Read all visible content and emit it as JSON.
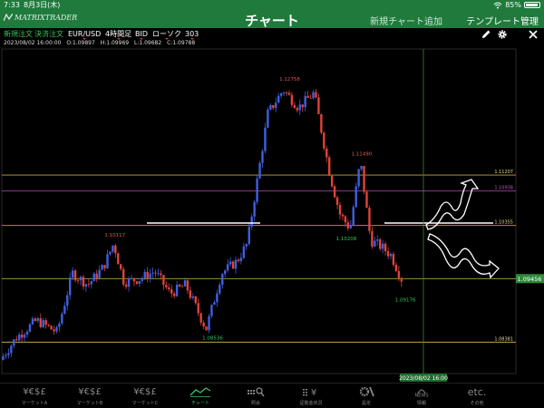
{
  "status_bar": {
    "time": "7:33",
    "date": "8月3日(木)",
    "battery_pct": "85%"
  },
  "header": {
    "logo": "MATRIXTRADER",
    "title": "チャート",
    "add_chart": "新規チャート追加",
    "template_manage": "テンプレート管理"
  },
  "toolbar": {
    "new_order": "新規注文",
    "settle_order": "決済注文",
    "symbol": "EUR/USD",
    "timeframe": "4時間足",
    "price_type": "BID",
    "chart_type": "ローソク",
    "count": "303"
  },
  "ohlc": {
    "datetime": "2023/08/02 16:00:00",
    "open": "O:1.09897",
    "high": "H:1.09969",
    "low": "L:1.09682",
    "close": "C:1.09788"
  },
  "chart_data": {
    "type": "candlestick",
    "ylim": [
      1.0785,
      1.1334
    ],
    "price_scale": [
      "1.11207",
      "1.10938",
      "1.10355",
      "1.09456",
      "1.08381"
    ],
    "current_price": "1.09456",
    "horizontal_lines": [
      {
        "price": 1.11207,
        "color": "#c8a43a"
      },
      {
        "price": 1.10938,
        "color": "#8a3a8a"
      },
      {
        "price": 1.10355,
        "color": "#c8a43a"
      },
      {
        "price": 1.08381,
        "color": "#c8a43a"
      },
      {
        "price": 1.09456,
        "color": "#9ab23a"
      }
    ],
    "annotations": [
      {
        "label": "1.12758",
        "x": 0.56,
        "price": 1.12758,
        "color": "#e05a5a"
      },
      {
        "label": "1.11490",
        "x": 0.7,
        "price": 1.1149,
        "color": "#e05a5a"
      },
      {
        "label": "1.10117",
        "x": 0.22,
        "price": 1.10117,
        "color": "#e05a5a"
      },
      {
        "label": "1.10208",
        "x": 0.67,
        "price": 1.10208,
        "color": "#3cc35a"
      },
      {
        "label": "1.08536",
        "x": 0.41,
        "price": 1.08536,
        "color": "#3cc35a"
      },
      {
        "label": "1.09176",
        "x": 0.785,
        "price": 1.09176,
        "color": "#3cc35a"
      }
    ],
    "cursor_label": "2023/08/02 16:00",
    "price_path": [
      [
        0.0,
        1.0808
      ],
      [
        0.03,
        1.0845
      ],
      [
        0.07,
        1.0875
      ],
      [
        0.11,
        1.0855
      ],
      [
        0.14,
        1.0955
      ],
      [
        0.17,
        1.0935
      ],
      [
        0.2,
        1.0965
      ],
      [
        0.22,
        1.1005
      ],
      [
        0.24,
        1.094
      ],
      [
        0.27,
        1.0945
      ],
      [
        0.3,
        1.0958
      ],
      [
        0.33,
        1.092
      ],
      [
        0.36,
        1.0935
      ],
      [
        0.4,
        1.086
      ],
      [
        0.43,
        1.0955
      ],
      [
        0.46,
        1.0975
      ],
      [
        0.48,
        1.1005
      ],
      [
        0.5,
        1.1115
      ],
      [
        0.52,
        1.1225
      ],
      [
        0.55,
        1.1265
      ],
      [
        0.58,
        1.1235
      ],
      [
        0.61,
        1.126
      ],
      [
        0.64,
        1.1125
      ],
      [
        0.66,
        1.1055
      ],
      [
        0.68,
        1.103
      ],
      [
        0.7,
        1.1145
      ],
      [
        0.72,
        1.101
      ],
      [
        0.74,
        1.1
      ],
      [
        0.76,
        1.0985
      ],
      [
        0.78,
        1.0945
      ]
    ]
  },
  "tabs": [
    {
      "icon": "¥€$£",
      "label": "マーケットA",
      "active": false
    },
    {
      "icon": "¥€$£",
      "label": "マーケットB",
      "active": false
    },
    {
      "icon": "¥€$£",
      "label": "マーケットC",
      "active": false
    },
    {
      "icon": "chart",
      "label": "チャート",
      "active": true
    },
    {
      "icon": "account",
      "label": "照会",
      "active": false
    },
    {
      "icon": "margin",
      "label": "証拠金状況",
      "active": false
    },
    {
      "icon": "settings",
      "label": "設定",
      "active": false
    },
    {
      "icon": "NEWS",
      "label": "情報",
      "active": false
    },
    {
      "icon": "etc.",
      "label": "その他",
      "active": false
    }
  ]
}
